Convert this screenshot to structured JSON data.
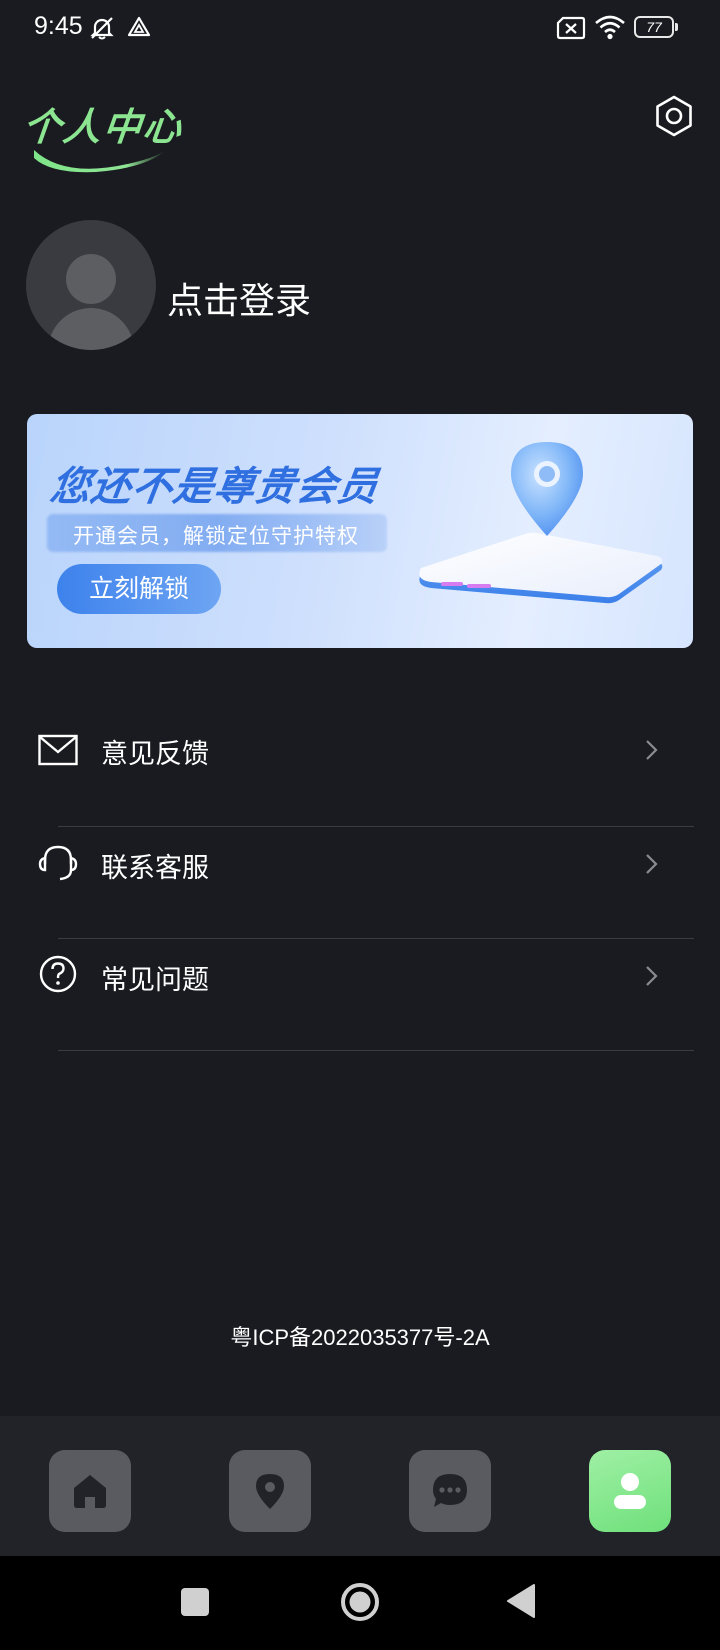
{
  "status_bar": {
    "time": "9:45",
    "battery_level": "77",
    "icons": [
      "bell-muted-icon",
      "triangle-a-icon",
      "sim-x-icon",
      "wifi-icon",
      "battery-icon"
    ]
  },
  "header": {
    "title": "个人中心",
    "settings_icon": "hexagon-settings-icon"
  },
  "profile": {
    "login_text": "点击登录"
  },
  "vip_banner": {
    "title": "您还不是尊贵会员",
    "subtitle": "开通会员，解锁定位守护特权",
    "button_label": "立刻解锁"
  },
  "menu": [
    {
      "label": "意见反馈",
      "icon": "envelope-icon"
    },
    {
      "label": "联系客服",
      "icon": "headset-icon"
    },
    {
      "label": "常见问题",
      "icon": "question-circle-icon"
    }
  ],
  "footer": {
    "icp": "粤ICP备2022035377号-2A"
  },
  "tab_bar": {
    "tabs": [
      {
        "icon": "home-icon",
        "active": false
      },
      {
        "icon": "location-pin-icon",
        "active": false
      },
      {
        "icon": "chat-bubble-icon",
        "active": false
      },
      {
        "icon": "person-icon",
        "active": true
      }
    ],
    "active_color": "#7ee585"
  },
  "colors": {
    "background": "#1a1b20",
    "accent_green": "#7ee585",
    "banner_blue": "#2f6fe0"
  }
}
